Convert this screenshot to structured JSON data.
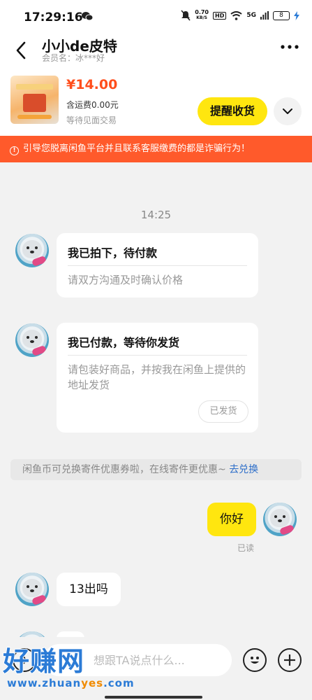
{
  "status_bar": {
    "time": "17:29:16",
    "net_speed_value": "0.70",
    "net_speed_unit": "KB/S",
    "hd_badge": "HD",
    "network": "5G",
    "battery": "8"
  },
  "header": {
    "seller_name": "小小de皮特",
    "member_line": "会员名：冰***好"
  },
  "product": {
    "price": "¥14.00",
    "shipping": "含运费0.00元",
    "trade_mode": "等待见面交易",
    "remind_button": "提醒收货"
  },
  "warning": {
    "icon": "!",
    "text": "引导您脱离闲鱼平台并且联系客服缴费的都是诈骗行为！"
  },
  "chat": {
    "timestamp": "14:25",
    "card_paid_pending": {
      "title": "我已拍下，待付款",
      "desc": "请双方沟通及时确认价格"
    },
    "card_paid": {
      "title": "我已付款，等待你发货",
      "desc": "请包装好商品，并按我在闲鱼上提供的地址发货",
      "button": "已发货"
    },
    "promo": {
      "text": "闲鱼币可兑换寄件优惠券啦，在线寄件更优惠~ ",
      "link": "去兑换"
    },
    "my_message": "你好",
    "read_status": "已读",
    "their_message": "13出吗"
  },
  "input": {
    "placeholder": "想跟TA说点什么..."
  },
  "watermark": {
    "brand": "好赚网",
    "url_a": "www.zhuan",
    "url_b": "yes",
    "url_c": ".com"
  },
  "colors": {
    "accent_yellow": "#ffe60f",
    "price_red": "#ff4e1c",
    "warning_orange": "#ff5a2b",
    "link_blue": "#2d6ec9"
  }
}
